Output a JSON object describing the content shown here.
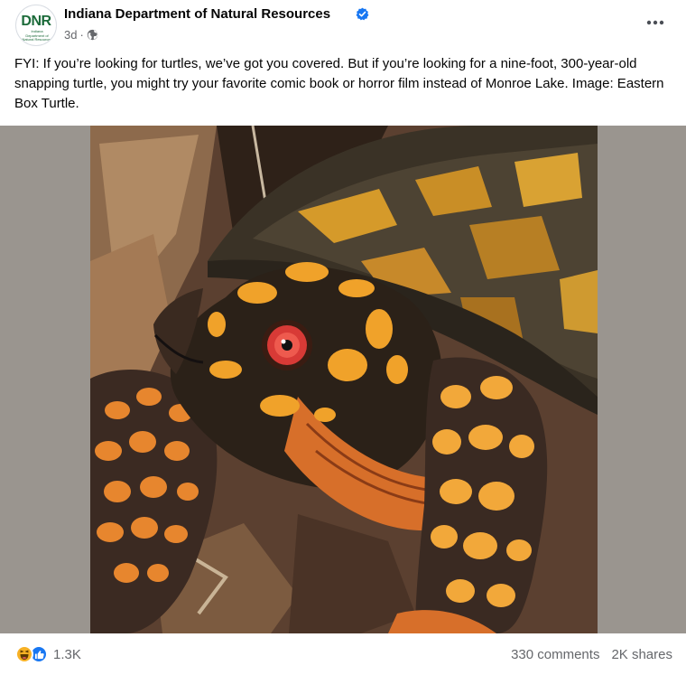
{
  "post": {
    "author": "Indiana Department of Natural Resources",
    "avatar_logo_text": "DNR",
    "avatar_logo_subtext": "Indiana Department of Natural Resources",
    "time": "3d",
    "separator": "·",
    "audience_icon": "globe-icon",
    "verified_icon": "verified-badge-icon",
    "more_icon": "more-options-icon",
    "text": "FYI: If you’re looking for turtles, we’ve got you covered. But if you’re looking for a nine-foot, 300-year-old snapping turtle, you might try your favorite comic book or horror film instead of Monroe Lake. Image: Eastern Box Turtle."
  },
  "photo": {
    "subject": "Eastern Box Turtle"
  },
  "footer": {
    "reaction_icons": [
      "haha-icon",
      "like-icon"
    ],
    "reaction_count": "1.3K",
    "comments": "330 comments",
    "shares": "2K shares"
  },
  "colors": {
    "verified": "#1877f2",
    "secondary_text": "#65676b",
    "photo_letterbox": "#9a958f",
    "like": "#1877f2",
    "haha": "#f7b125"
  }
}
